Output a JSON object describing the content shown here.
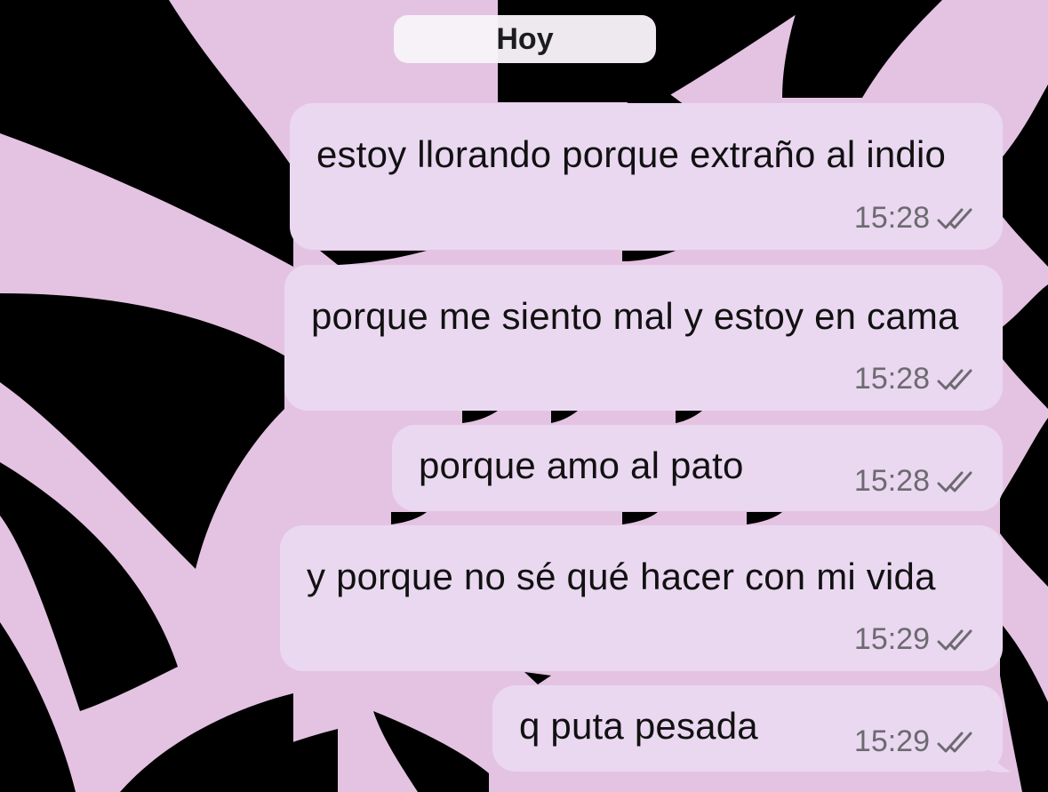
{
  "chat": {
    "date_separator": "Hoy",
    "messages": [
      {
        "text": "estoy llorando porque extraño al indio",
        "time": "15:28",
        "status": "double-check-icon"
      },
      {
        "text": "porque me siento mal y estoy en cama",
        "time": "15:28",
        "status": "double-check-icon"
      },
      {
        "text": "porque amo al pato",
        "time": "15:28",
        "status": "double-check-icon"
      },
      {
        "text": "y porque no sé qué hacer con mi vida",
        "time": "15:29",
        "status": "double-check-icon"
      },
      {
        "text": "q puta pesada",
        "time": "15:29",
        "status": "double-check-icon"
      }
    ]
  },
  "colors": {
    "wallpaper_pink": "#e4c3e2",
    "wallpaper_black": "#000000",
    "bubble": "#ead8f1",
    "meta_text": "#6d6a70"
  }
}
